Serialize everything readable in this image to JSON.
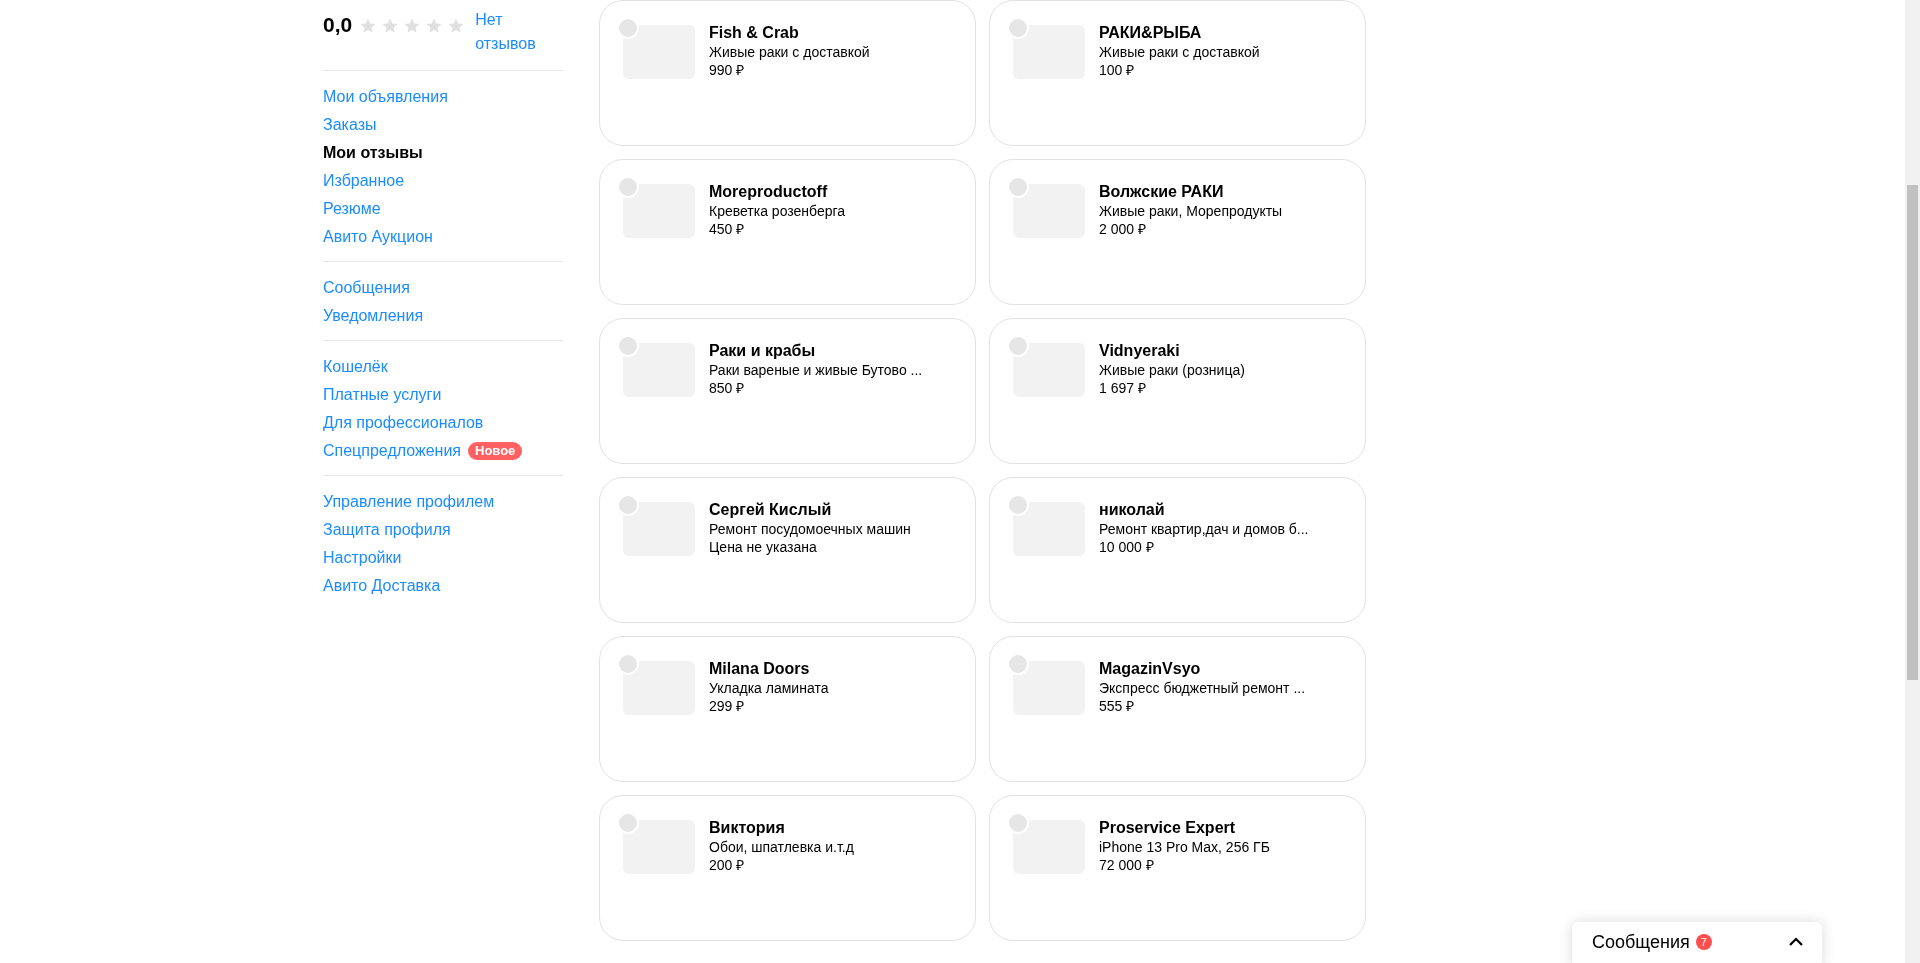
{
  "rating": {
    "score": "0,0",
    "stars": 0,
    "reviews_link": "Нет отзывов"
  },
  "sidebar": {
    "groups": [
      {
        "items": [
          {
            "label": "Мои объявления",
            "selected": false
          },
          {
            "label": "Заказы",
            "selected": false
          },
          {
            "label": "Мои отзывы",
            "selected": true
          },
          {
            "label": "Избранное",
            "selected": false
          },
          {
            "label": "Резюме",
            "selected": false
          },
          {
            "label": "Авито Аукцион",
            "selected": false
          }
        ]
      },
      {
        "items": [
          {
            "label": "Сообщения",
            "selected": false
          },
          {
            "label": "Уведомления",
            "selected": false
          }
        ]
      },
      {
        "items": [
          {
            "label": "Кошелёк",
            "selected": false
          },
          {
            "label": "Платные услуги",
            "selected": false
          },
          {
            "label": "Для профессионалов",
            "selected": false
          },
          {
            "label": "Спецпредложения",
            "selected": false,
            "badge": "Новое"
          }
        ]
      },
      {
        "items": [
          {
            "label": "Управление профилем",
            "selected": false
          },
          {
            "label": "Защита профиля",
            "selected": false
          },
          {
            "label": "Настройки",
            "selected": false
          },
          {
            "label": "Авито Доставка",
            "selected": false
          }
        ]
      }
    ]
  },
  "cards": [
    {
      "title": "Fish & Crab",
      "description": "Живые раки с доставкой",
      "price": "990 ₽"
    },
    {
      "title": "РАКИ&РЫБА",
      "description": "Живые раки с доставкой",
      "price": "100 ₽"
    },
    {
      "title": "Moreproductoff",
      "description": "Креветка розенберга",
      "price": "450 ₽"
    },
    {
      "title": "Волжские РАКИ",
      "description": "Живые раки, Морепродукты",
      "price": "2 000 ₽"
    },
    {
      "title": "Раки и крабы",
      "description": "Раки вареные и живые Бутово ...",
      "price": "850 ₽"
    },
    {
      "title": "Vidnyeraki",
      "description": "Живые раки (розница)",
      "price": "1 697 ₽"
    },
    {
      "title": "Сергей Кислый",
      "description": "Ремонт посудомоечных машин",
      "price": "Цена не указана"
    },
    {
      "title": "николай",
      "description": "Ремонт квартир,дач и домов б...",
      "price": "10 000 ₽"
    },
    {
      "title": "Milana Doors",
      "description": "Укладка ламината",
      "price": "299 ₽"
    },
    {
      "title": "MagazinVsyo",
      "description": "Экспресс бюджетный ремонт ...",
      "price": "555 ₽"
    },
    {
      "title": "Виктория",
      "description": "Обои, шпатлевка и.т.д",
      "price": "200 ₽"
    },
    {
      "title": "Proservice Expert",
      "description": "iPhone 13 Pro Max, 256 ГБ",
      "price": "72 000 ₽"
    }
  ],
  "messages_widget": {
    "title": "Сообщения",
    "count": "7",
    "expanded": false
  }
}
